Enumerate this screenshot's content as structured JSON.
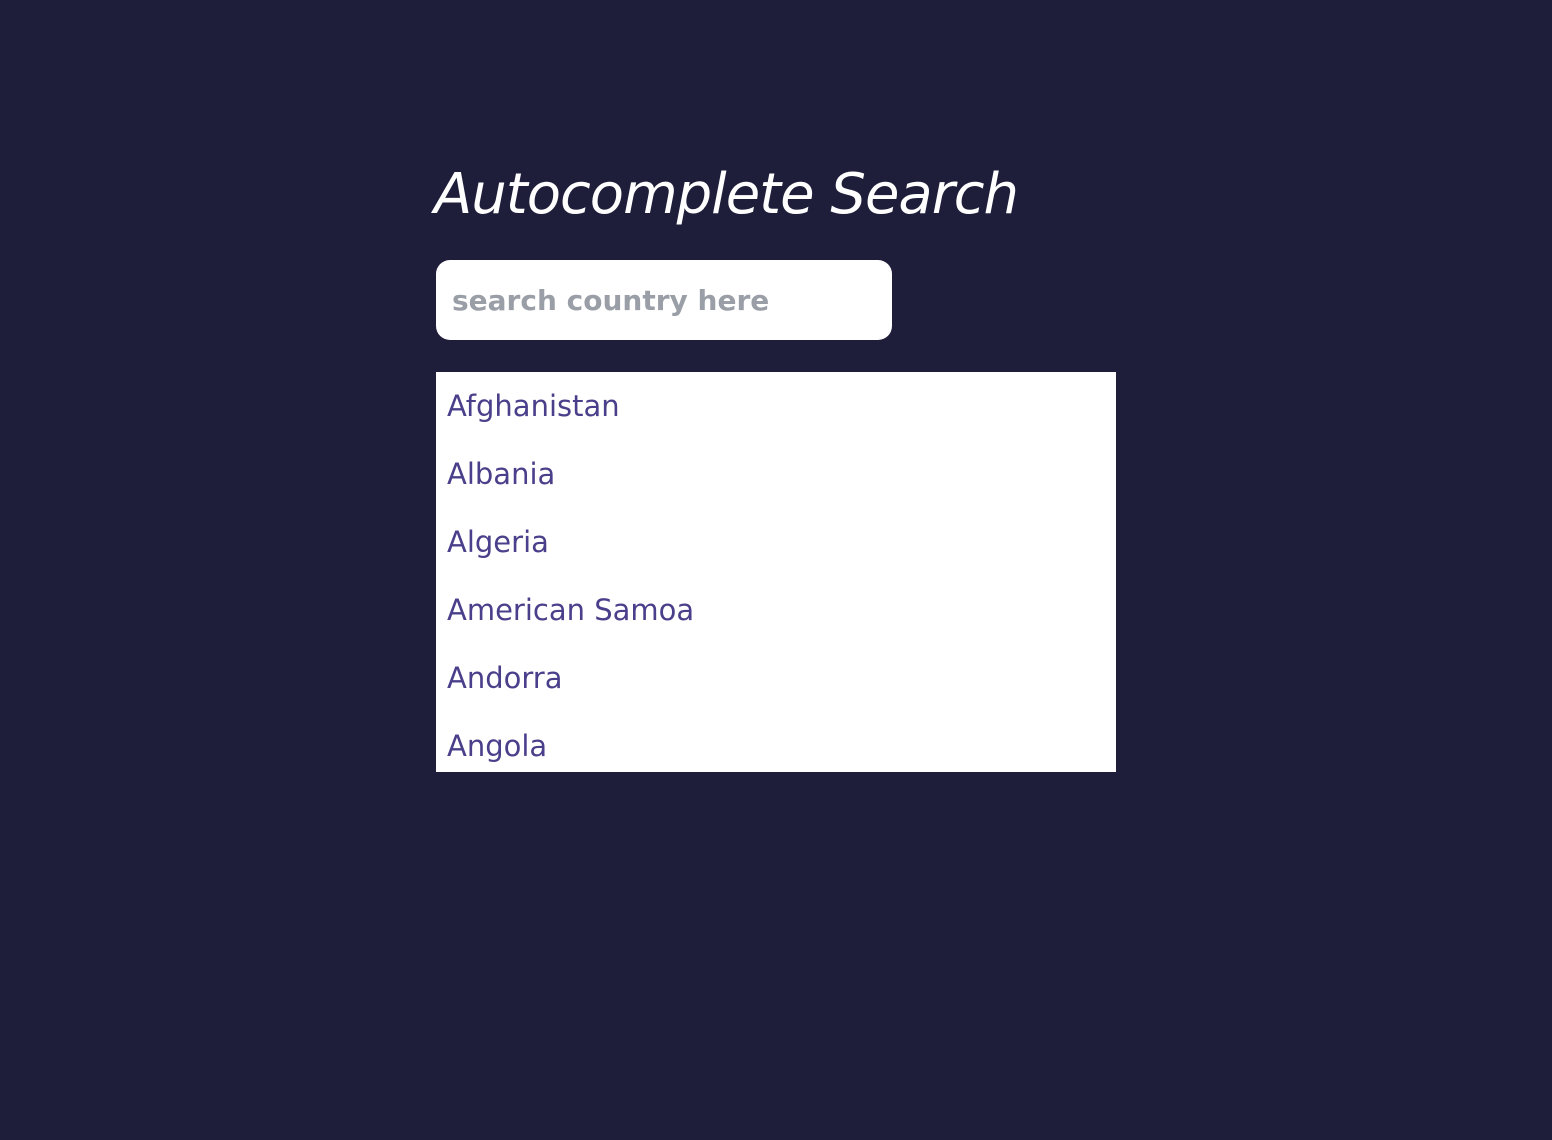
{
  "header": {
    "title": "Autocomplete Search"
  },
  "search": {
    "placeholder": "search country here",
    "value": ""
  },
  "results": {
    "items": [
      "Afghanistan",
      "Albania",
      "Algeria",
      "American Samoa",
      "Andorra",
      "Angola"
    ]
  },
  "colors": {
    "background": "#1e1e3a",
    "title": "#ffffff",
    "input_background": "#ffffff",
    "placeholder": "#9a9ea6",
    "result_text": "#4a3f8a",
    "results_background": "#ffffff"
  }
}
